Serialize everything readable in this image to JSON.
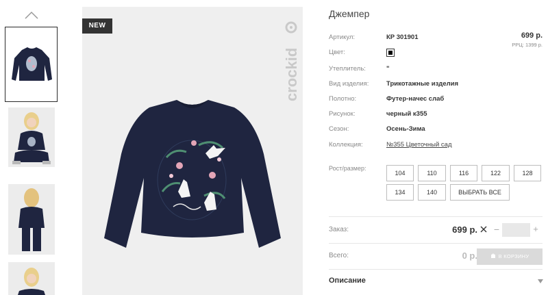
{
  "product": {
    "title": "Джемпер",
    "badge": "NEW",
    "brand": "crockid",
    "price": "699 р.",
    "rrp": "РРЦ: 1399 р."
  },
  "attributes": [
    {
      "label": "Артикул:",
      "value": "КР 301901"
    },
    {
      "label": "Цвет:",
      "value": ""
    },
    {
      "label": "Утеплитель:",
      "value": "\""
    },
    {
      "label": "Вид изделия:",
      "value": "Трикотажные изделия"
    },
    {
      "label": "Полотно:",
      "value": "Футер-начес слаб"
    },
    {
      "label": "Рисунок:",
      "value": "черный к355"
    },
    {
      "label": "Сезон:",
      "value": "Осень-Зима"
    },
    {
      "label": "Коллекция:",
      "value": "№355 Цветочный сад"
    }
  ],
  "color_swatch": "#000000",
  "sizes": {
    "label": "Рост/размер:",
    "options": [
      "104",
      "110",
      "116",
      "122",
      "128",
      "134",
      "140"
    ],
    "select_all": "ВЫБРАТЬ ВСЕ"
  },
  "order": {
    "label": "Заказ:",
    "price": "699 р.",
    "qty_value": ""
  },
  "total": {
    "label": "Всего:",
    "price": "0 р.",
    "cart_button": "В КОРЗИНУ"
  },
  "description": {
    "label": "Описание"
  },
  "icons": {
    "thumb_up": "chevron-up-icon",
    "remove": "close-icon",
    "cart": "cart-icon",
    "expand": "chevron-down-icon"
  },
  "colors": {
    "navy": "#1f2540",
    "dark": "#333333",
    "muted": "#888888"
  }
}
